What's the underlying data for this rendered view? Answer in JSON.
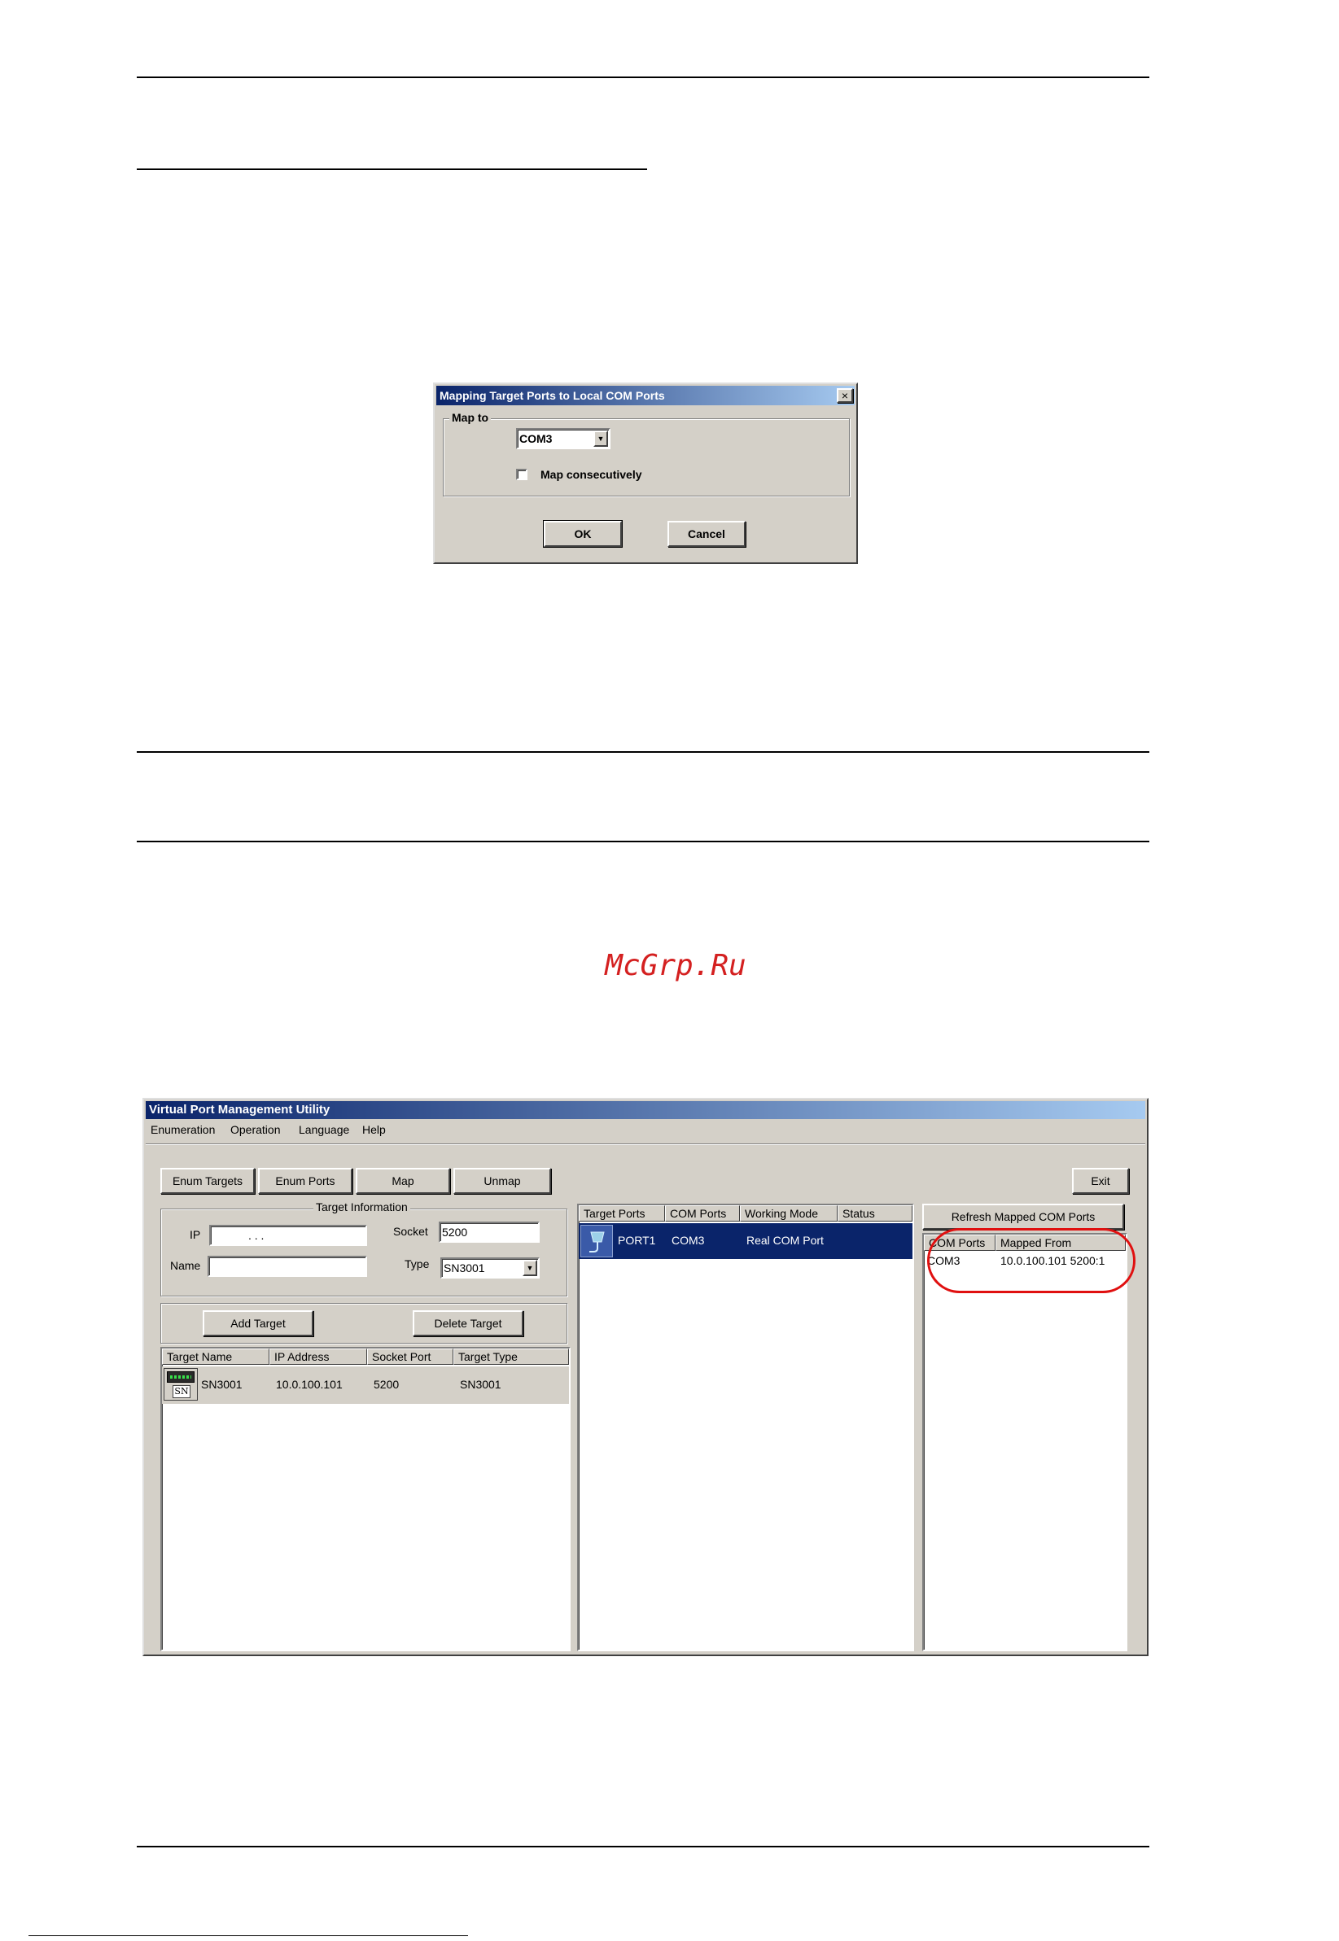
{
  "watermark": "McGrp.Ru",
  "dialog": {
    "title": "Mapping Target Ports to Local COM Ports",
    "group_label": "Map to",
    "com_selected": "COM3",
    "checkbox_label": "Map consecutively",
    "ok_label": "OK",
    "cancel_label": "Cancel",
    "close_glyph": "×"
  },
  "app": {
    "title": "Virtual Port Management Utility",
    "menu": [
      "Enumeration",
      "Operation",
      "Language",
      "Help"
    ],
    "toolbar": {
      "enum_targets": "Enum Targets",
      "enum_ports": "Enum Ports",
      "map": "Map",
      "unmap": "Unmap",
      "exit": "Exit"
    },
    "target_info": {
      "group_label": "Target Information",
      "ip_label": "IP",
      "ip_value": ".       .       .",
      "socket_label": "Socket",
      "socket_value": "5200",
      "name_label": "Name",
      "name_value": "",
      "type_label": "Type",
      "type_value": "SN3001"
    },
    "add_target": "Add Target",
    "delete_target": "Delete Target",
    "targets_table": {
      "headers": [
        "Target Name",
        "IP Address",
        "Socket Port",
        "Target Type"
      ],
      "rows": [
        {
          "name": "SN3001",
          "ip": "10.0.100.101",
          "socket": "5200",
          "type": "SN3001",
          "icon_text": "SN"
        }
      ]
    },
    "ports_table": {
      "headers": [
        "Target Ports",
        "COM Ports",
        "Working Mode",
        "Status"
      ],
      "rows": [
        {
          "port": "PORT1",
          "com": "COM3",
          "mode": "Real COM Port",
          "status": ""
        }
      ]
    },
    "refresh_button": "Refresh Mapped COM Ports",
    "mapped_table": {
      "headers": [
        "COM Ports",
        "Mapped From"
      ],
      "rows": [
        {
          "com": "COM3",
          "from": "10.0.100.101 5200:1"
        }
      ]
    }
  },
  "colors": {
    "selection": "#0a246a",
    "highlight_circle": "#e01010",
    "window_bg": "#d4d0c8"
  }
}
